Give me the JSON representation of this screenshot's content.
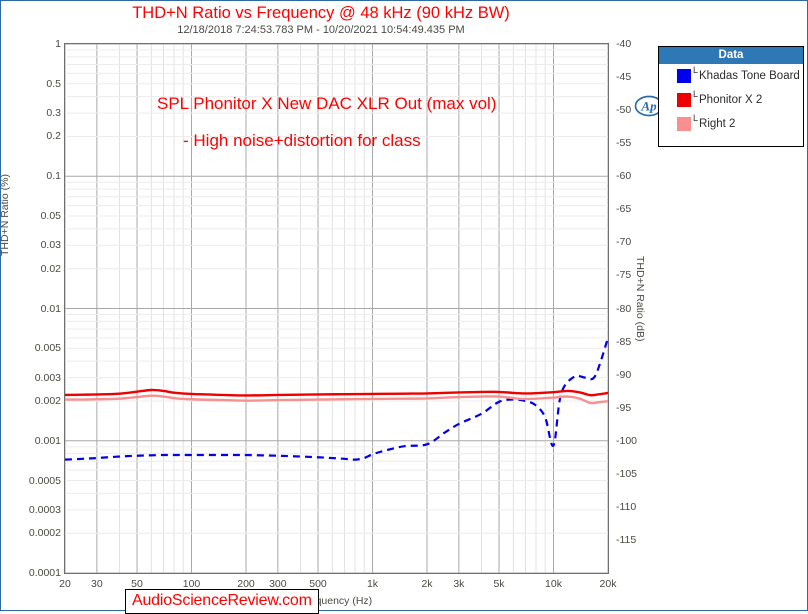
{
  "header": {
    "title": "THD+N Ratio vs Frequency @ 48 kHz (90 kHz BW)",
    "subtitle": "12/18/2018 7:24:53.783 PM - 10/20/2021 10:54:49.435 PM"
  },
  "annotations": {
    "line1": "SPL Phonitor X New DAC XLR Out (max vol)",
    "line2": "- High noise+distortion for class",
    "watermark": "AudioScienceReview.com",
    "logo": "ap-logo-icon"
  },
  "legend": {
    "header": "Data",
    "items": [
      {
        "label": "Khadas Tone Board",
        "color": "#0000ee",
        "marker": "L"
      },
      {
        "label": "Phonitor X  2",
        "color": "#ee0000",
        "marker": "L"
      },
      {
        "label": "Right 2",
        "color": "#f98f8f",
        "marker": "L"
      }
    ]
  },
  "chart_data": {
    "type": "line",
    "title": "THD+N Ratio vs Frequency @ 48 kHz (90 kHz BW)",
    "subtitle": "12/18/2018 7:24:53.783 PM - 10/20/2021 10:54:49.435 PM",
    "xlabel": "Frequency (Hz)",
    "ylabel": "THD+N Ratio (%)",
    "ylabel_right": "THD+N Ratio (dB)",
    "xscale": "log",
    "yscale": "log",
    "xlim": [
      20,
      20000
    ],
    "ylim": [
      0.0001,
      1
    ],
    "ylim_right": [
      -120,
      -40
    ],
    "grid": true,
    "legend_position": "outside-right-top",
    "xticks": [
      "20",
      "30",
      "50",
      "100",
      "200",
      "300",
      "500",
      "1k",
      "2k",
      "3k",
      "5k",
      "10k",
      "20k"
    ],
    "xtick_values": [
      20,
      30,
      50,
      100,
      200,
      300,
      500,
      1000,
      2000,
      3000,
      5000,
      10000,
      20000
    ],
    "yticks_left": [
      "1",
      "0.5",
      "0.3",
      "0.2",
      "0.1",
      "0.05",
      "0.03",
      "0.02",
      "0.01",
      "0.005",
      "0.003",
      "0.002",
      "0.001",
      "0.0005",
      "0.0003",
      "0.0002",
      "0.0001"
    ],
    "ytick_values_left": [
      1,
      0.5,
      0.3,
      0.2,
      0.1,
      0.05,
      0.03,
      0.02,
      0.01,
      0.005,
      0.003,
      0.002,
      0.001,
      0.0005,
      0.0003,
      0.0002,
      0.0001
    ],
    "yticks_right": [
      "-40",
      "-45",
      "-50",
      "-55",
      "-60",
      "-65",
      "-70",
      "-75",
      "-80",
      "-85",
      "-90",
      "-95",
      "-100",
      "-105",
      "-110",
      "-115"
    ],
    "ytick_values_right": [
      -40,
      -45,
      -50,
      -55,
      -60,
      -65,
      -70,
      -75,
      -80,
      -85,
      -90,
      -95,
      -100,
      -105,
      -110,
      -115
    ],
    "series": [
      {
        "name": "Khadas Tone Board",
        "color": "#0000ee",
        "style": "dashed",
        "width": 2.2,
        "x": [
          20,
          25,
          30,
          40,
          50,
          70,
          100,
          150,
          200,
          300,
          400,
          500,
          600,
          700,
          800,
          900,
          1000,
          1200,
          1500,
          2000,
          2500,
          3000,
          4000,
          5000,
          6000,
          7000,
          8000,
          9000,
          10000,
          11000,
          13000,
          15000,
          17000,
          20000
        ],
        "y": [
          0.00072,
          0.00073,
          0.00074,
          0.00076,
          0.00077,
          0.00078,
          0.00078,
          0.00078,
          0.00078,
          0.00077,
          0.00076,
          0.00075,
          0.00074,
          0.00073,
          0.00072,
          0.00074,
          0.00079,
          0.00085,
          0.00091,
          0.00094,
          0.00115,
          0.00134,
          0.0016,
          0.00197,
          0.00205,
          0.002,
          0.00185,
          0.0015,
          0.00092,
          0.00225,
          0.00305,
          0.003,
          0.0031,
          0.006
        ]
      },
      {
        "name": "Phonitor X  2",
        "color": "#ee0000",
        "style": "solid",
        "width": 2.4,
        "x": [
          20,
          25,
          30,
          40,
          50,
          60,
          70,
          80,
          100,
          150,
          200,
          300,
          400,
          500,
          700,
          1000,
          1500,
          2000,
          3000,
          4000,
          5000,
          6000,
          7000,
          8000,
          10000,
          12000,
          14000,
          16000,
          18000,
          20000
        ],
        "y": [
          0.00222,
          0.00223,
          0.00224,
          0.00227,
          0.00235,
          0.00242,
          0.00238,
          0.00231,
          0.00226,
          0.00222,
          0.0022,
          0.00222,
          0.00223,
          0.00224,
          0.00225,
          0.00226,
          0.00227,
          0.00228,
          0.00232,
          0.00234,
          0.00234,
          0.0023,
          0.00228,
          0.00229,
          0.00233,
          0.00238,
          0.00232,
          0.00221,
          0.00225,
          0.0023
        ]
      },
      {
        "name": "Right 2",
        "color": "#f98f8f",
        "style": "solid",
        "width": 2.4,
        "x": [
          20,
          25,
          30,
          40,
          50,
          60,
          70,
          80,
          100,
          150,
          200,
          300,
          400,
          500,
          700,
          1000,
          1500,
          2000,
          3000,
          4000,
          5000,
          6000,
          7000,
          8000,
          10000,
          12000,
          14000,
          16000,
          18000,
          20000
        ],
        "y": [
          0.00205,
          0.00205,
          0.00206,
          0.00208,
          0.00214,
          0.00219,
          0.00216,
          0.0021,
          0.00206,
          0.00203,
          0.00201,
          0.00203,
          0.00204,
          0.00205,
          0.00206,
          0.00207,
          0.00208,
          0.00209,
          0.00214,
          0.00216,
          0.00216,
          0.0021,
          0.00207,
          0.00208,
          0.00212,
          0.00216,
          0.00208,
          0.00193,
          0.00196,
          0.00199
        ]
      }
    ]
  }
}
